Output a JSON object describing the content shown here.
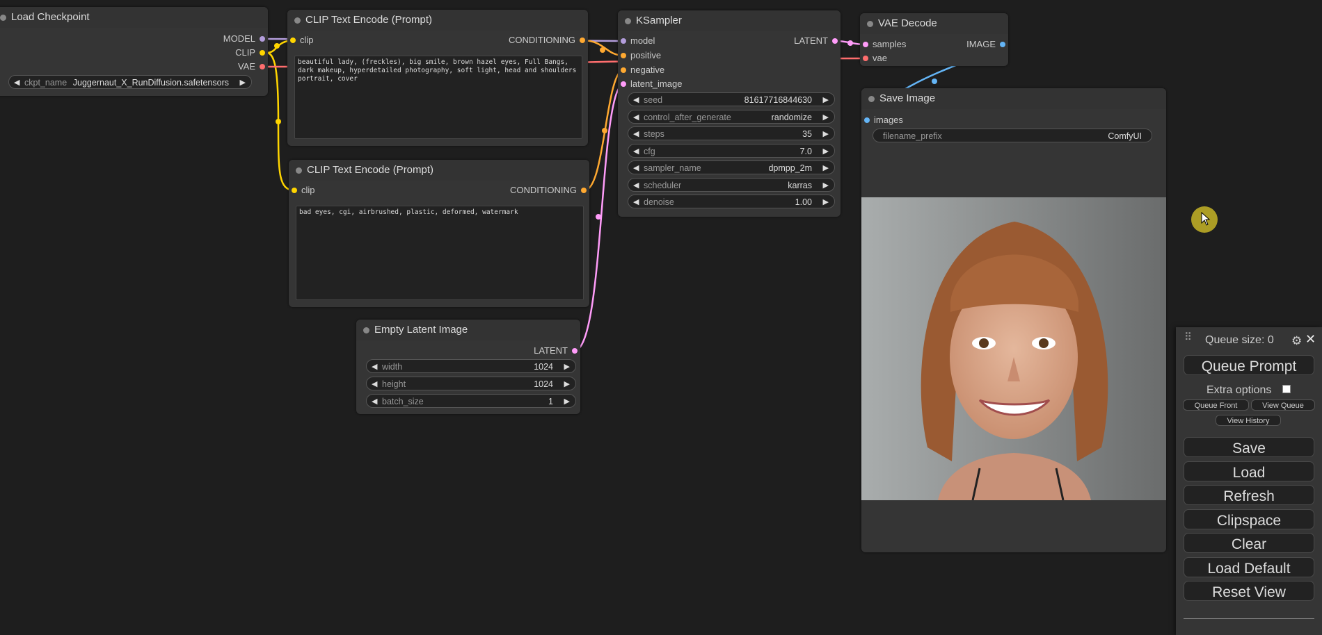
{
  "colors": {
    "model": "#b39ddb",
    "clip": "#ffd500",
    "vae": "#ff6e6e",
    "conditioning": "#ffa931",
    "latent": "#ff9cf9",
    "image": "#64b5f6"
  },
  "load_checkpoint": {
    "title": "Load Checkpoint",
    "outputs": [
      "MODEL",
      "CLIP",
      "VAE"
    ],
    "ckpt_name_label": "ckpt_name",
    "ckpt_name_value": "Juggernaut_X_RunDiffusion.safetensors"
  },
  "clip_pos": {
    "title": "CLIP Text Encode (Prompt)",
    "input": "clip",
    "output": "CONDITIONING",
    "text": "beautiful lady, (freckles), big smile, brown hazel eyes, Full Bangs, dark makeup, hyperdetailed photography, soft light, head and shoulders portrait, cover"
  },
  "clip_neg": {
    "title": "CLIP Text Encode (Prompt)",
    "input": "clip",
    "output": "CONDITIONING",
    "text": "bad eyes, cgi, airbrushed, plastic, deformed, watermark"
  },
  "empty_latent": {
    "title": "Empty Latent Image",
    "output": "LATENT",
    "widgets": [
      {
        "name": "width",
        "value": "1024"
      },
      {
        "name": "height",
        "value": "1024"
      },
      {
        "name": "batch_size",
        "value": "1"
      }
    ]
  },
  "ksampler": {
    "title": "KSampler",
    "inputs": [
      "model",
      "positive",
      "negative",
      "latent_image"
    ],
    "output": "LATENT",
    "widgets": [
      {
        "name": "seed",
        "value": "81617716844630"
      },
      {
        "name": "control_after_generate",
        "value": "randomize"
      },
      {
        "name": "steps",
        "value": "35"
      },
      {
        "name": "cfg",
        "value": "7.0"
      },
      {
        "name": "sampler_name",
        "value": "dpmpp_2m"
      },
      {
        "name": "scheduler",
        "value": "karras"
      },
      {
        "name": "denoise",
        "value": "1.00"
      }
    ]
  },
  "vae_decode": {
    "title": "VAE Decode",
    "inputs": [
      "samples",
      "vae"
    ],
    "output": "IMAGE"
  },
  "save_image": {
    "title": "Save Image",
    "input": "images",
    "filename_prefix_label": "filename_prefix",
    "filename_prefix_value": "ComfyUI"
  },
  "menu": {
    "queue_size": "Queue size: 0",
    "queue_prompt": "Queue Prompt",
    "extra_options": "Extra options",
    "queue_front": "Queue Front",
    "view_queue": "View Queue",
    "view_history": "View History",
    "buttons": [
      "Save",
      "Load",
      "Refresh",
      "Clipspace",
      "Clear",
      "Load Default",
      "Reset View"
    ]
  }
}
